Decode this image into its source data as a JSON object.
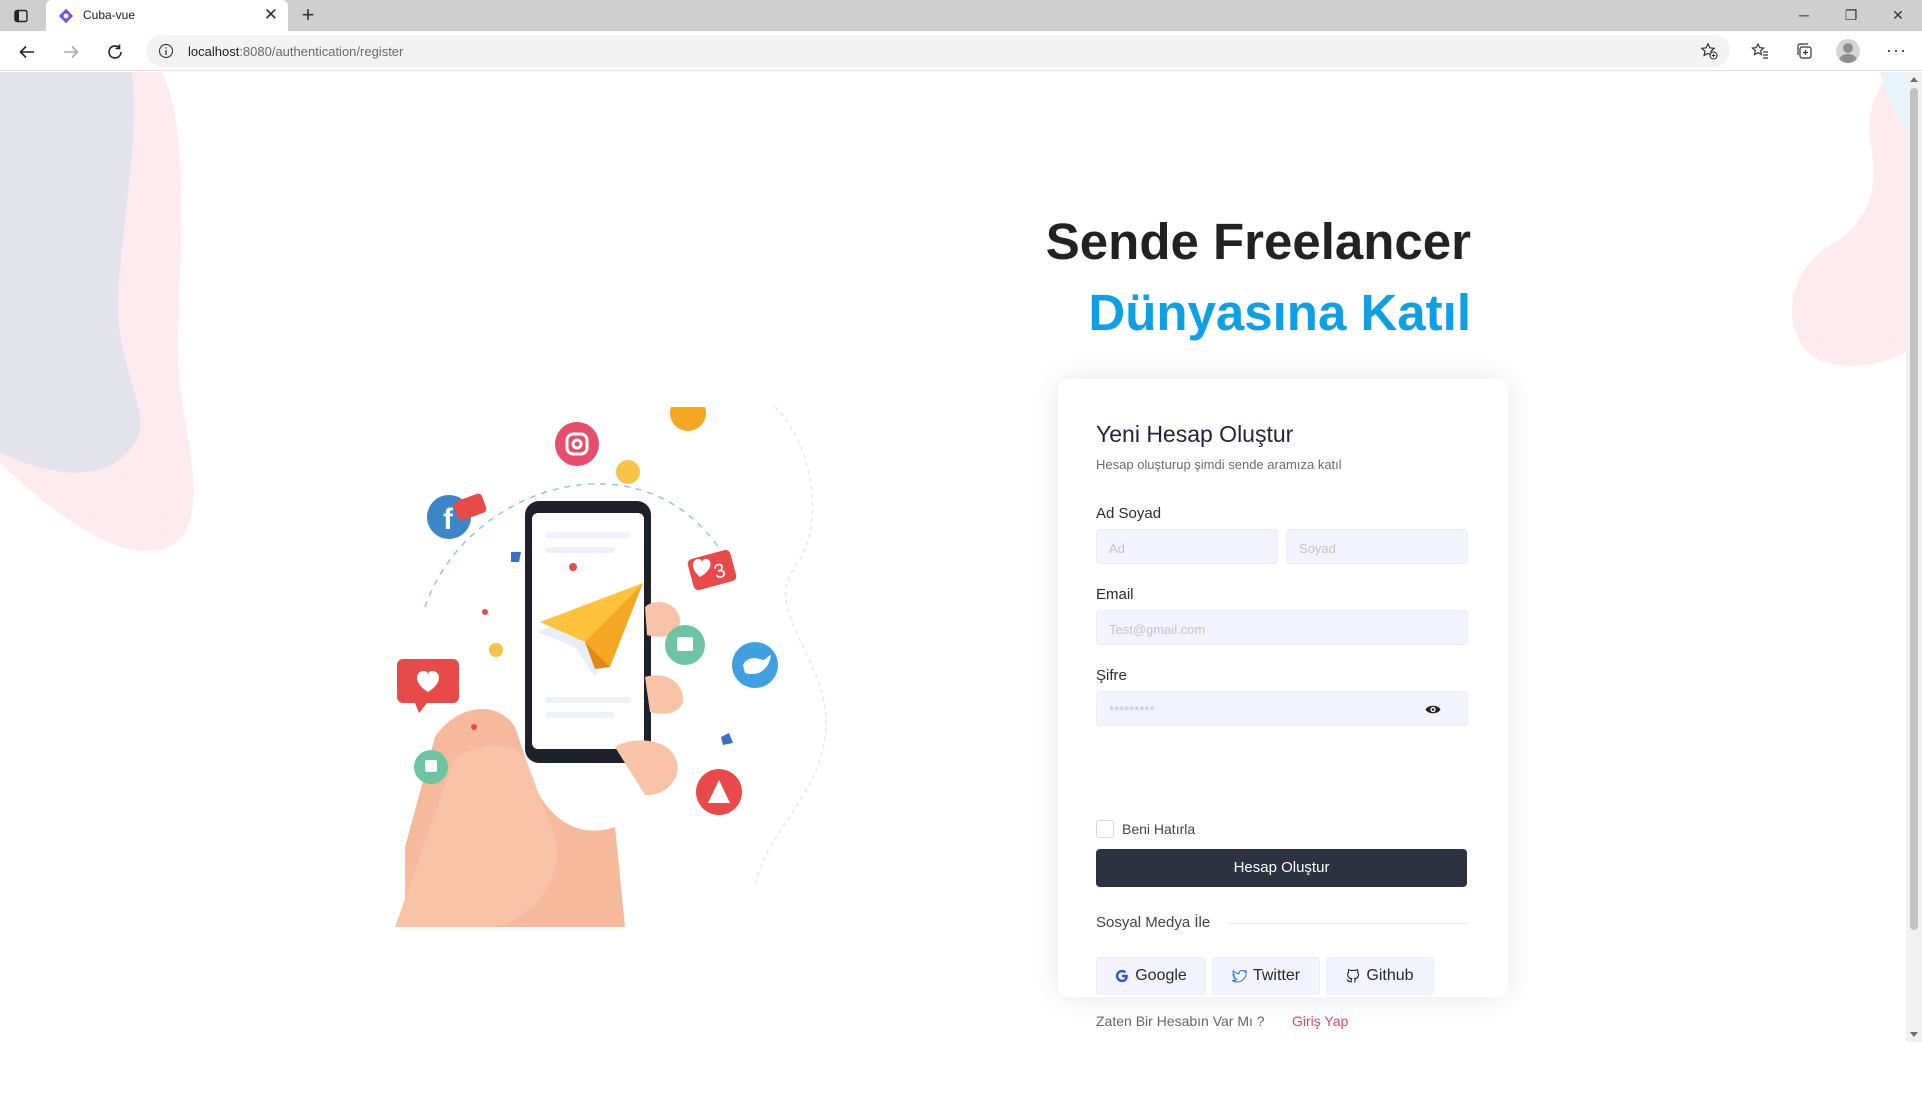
{
  "browser": {
    "tab_title": "Cuba-vue",
    "url_host": "localhost",
    "url_rest": ":8080/authentication/register",
    "icons": [
      "tab-actions-icon",
      "close-icon",
      "plus-icon",
      "minimize-icon",
      "restore-icon",
      "window-close-icon",
      "back-icon",
      "forward-icon",
      "reload-icon",
      "info-icon",
      "favorite-add-icon",
      "favorites-icon",
      "collections-icon",
      "profile-icon",
      "more-icon"
    ]
  },
  "hero": {
    "line1": "Sende Freelancer",
    "line2": "Dünyasına Katıl"
  },
  "form": {
    "title": "Yeni Hesap Oluştur",
    "subtitle": "Hesap oluşturup şimdi sende aramıza katıl",
    "name_label": "Ad Soyad",
    "first_placeholder": "Ad",
    "last_placeholder": "Soyad",
    "email_label": "Email",
    "email_placeholder": "Test@gmail.com",
    "password_label": "Şifre",
    "password_placeholder": "*********",
    "remember_label": "Beni Hatırla",
    "remember_checked": false,
    "submit_label": "Hesap Oluştur",
    "social_label": "Sosyal Medya İle",
    "google_label": "Google",
    "twitter_label": "Twitter",
    "github_label": "Github",
    "footer_question": "Zaten Bir Hesabın Var Mı ?",
    "login_link": "Giriş Yap"
  },
  "colors": {
    "accent_blue": "#0f9fe5",
    "button_dark": "#2c323f",
    "link_pink": "#e2456a",
    "input_bg": "#f3f3fd"
  }
}
